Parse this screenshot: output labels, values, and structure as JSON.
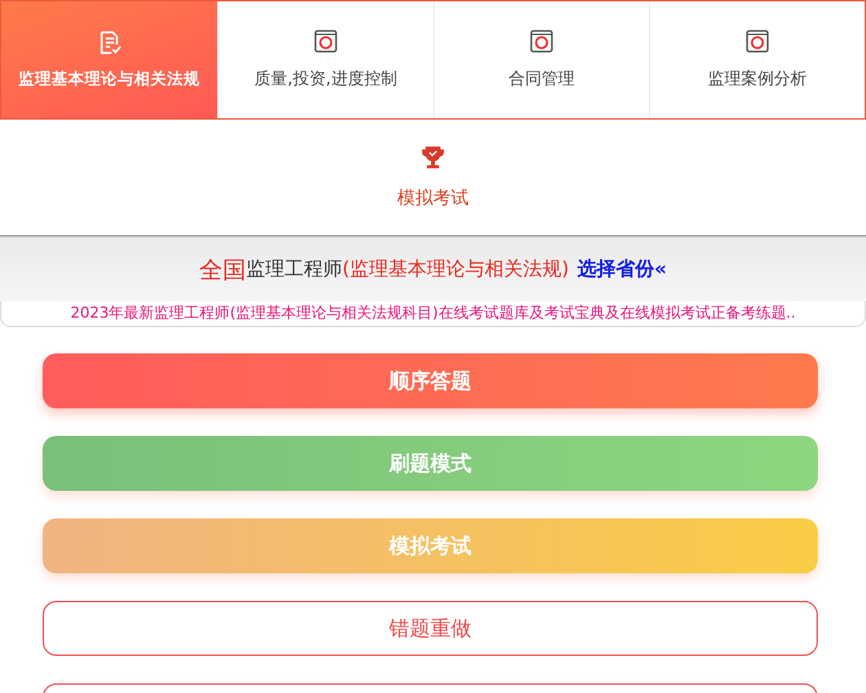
{
  "tabs": [
    {
      "label": "监理基本理论与相关法规",
      "kind": "document",
      "selected": true
    },
    {
      "label": "质量,投资,进度控制",
      "kind": "book",
      "selected": false
    },
    {
      "label": "合同管理",
      "kind": "book",
      "selected": false
    },
    {
      "label": "监理案例分析",
      "kind": "book",
      "selected": false
    },
    {
      "label": "模拟考试",
      "kind": "trophy",
      "selected": false
    }
  ],
  "heading": {
    "scope": "全国",
    "title": "监理工程师",
    "subject": "(监理基本理论与相关法规)",
    "link": "选择省份«"
  },
  "notice": "2023年最新监理工程师(监理基本理论与相关法规科目)在线考试题库及考试宝典及在线模拟考试正备考练题..",
  "actions": [
    {
      "label": "顺序答题",
      "kind": "red"
    },
    {
      "label": "刷题模式",
      "kind": "green"
    },
    {
      "label": "模拟考试",
      "kind": "orange"
    },
    {
      "label": "错题重做",
      "kind": "outline"
    },
    {
      "kind": "outline"
    }
  ]
}
